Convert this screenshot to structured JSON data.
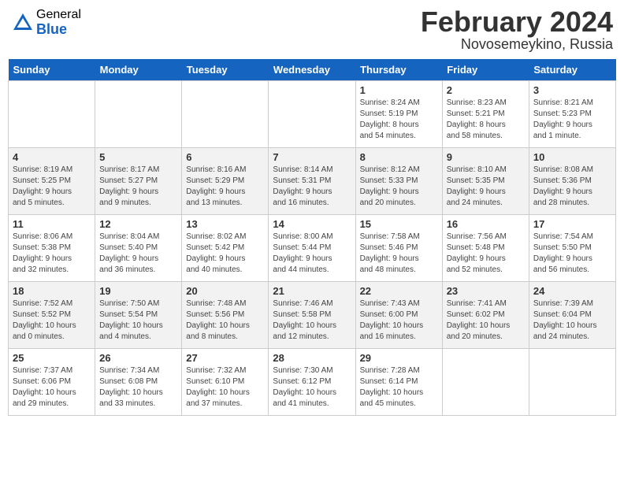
{
  "logo": {
    "general": "General",
    "blue": "Blue"
  },
  "title": {
    "month_year": "February 2024",
    "location": "Novosemeykino, Russia"
  },
  "headers": [
    "Sunday",
    "Monday",
    "Tuesday",
    "Wednesday",
    "Thursday",
    "Friday",
    "Saturday"
  ],
  "weeks": [
    [
      {
        "day": "",
        "info": ""
      },
      {
        "day": "",
        "info": ""
      },
      {
        "day": "",
        "info": ""
      },
      {
        "day": "",
        "info": ""
      },
      {
        "day": "1",
        "info": "Sunrise: 8:24 AM\nSunset: 5:19 PM\nDaylight: 8 hours\nand 54 minutes."
      },
      {
        "day": "2",
        "info": "Sunrise: 8:23 AM\nSunset: 5:21 PM\nDaylight: 8 hours\nand 58 minutes."
      },
      {
        "day": "3",
        "info": "Sunrise: 8:21 AM\nSunset: 5:23 PM\nDaylight: 9 hours\nand 1 minute."
      }
    ],
    [
      {
        "day": "4",
        "info": "Sunrise: 8:19 AM\nSunset: 5:25 PM\nDaylight: 9 hours\nand 5 minutes."
      },
      {
        "day": "5",
        "info": "Sunrise: 8:17 AM\nSunset: 5:27 PM\nDaylight: 9 hours\nand 9 minutes."
      },
      {
        "day": "6",
        "info": "Sunrise: 8:16 AM\nSunset: 5:29 PM\nDaylight: 9 hours\nand 13 minutes."
      },
      {
        "day": "7",
        "info": "Sunrise: 8:14 AM\nSunset: 5:31 PM\nDaylight: 9 hours\nand 16 minutes."
      },
      {
        "day": "8",
        "info": "Sunrise: 8:12 AM\nSunset: 5:33 PM\nDaylight: 9 hours\nand 20 minutes."
      },
      {
        "day": "9",
        "info": "Sunrise: 8:10 AM\nSunset: 5:35 PM\nDaylight: 9 hours\nand 24 minutes."
      },
      {
        "day": "10",
        "info": "Sunrise: 8:08 AM\nSunset: 5:36 PM\nDaylight: 9 hours\nand 28 minutes."
      }
    ],
    [
      {
        "day": "11",
        "info": "Sunrise: 8:06 AM\nSunset: 5:38 PM\nDaylight: 9 hours\nand 32 minutes."
      },
      {
        "day": "12",
        "info": "Sunrise: 8:04 AM\nSunset: 5:40 PM\nDaylight: 9 hours\nand 36 minutes."
      },
      {
        "day": "13",
        "info": "Sunrise: 8:02 AM\nSunset: 5:42 PM\nDaylight: 9 hours\nand 40 minutes."
      },
      {
        "day": "14",
        "info": "Sunrise: 8:00 AM\nSunset: 5:44 PM\nDaylight: 9 hours\nand 44 minutes."
      },
      {
        "day": "15",
        "info": "Sunrise: 7:58 AM\nSunset: 5:46 PM\nDaylight: 9 hours\nand 48 minutes."
      },
      {
        "day": "16",
        "info": "Sunrise: 7:56 AM\nSunset: 5:48 PM\nDaylight: 9 hours\nand 52 minutes."
      },
      {
        "day": "17",
        "info": "Sunrise: 7:54 AM\nSunset: 5:50 PM\nDaylight: 9 hours\nand 56 minutes."
      }
    ],
    [
      {
        "day": "18",
        "info": "Sunrise: 7:52 AM\nSunset: 5:52 PM\nDaylight: 10 hours\nand 0 minutes."
      },
      {
        "day": "19",
        "info": "Sunrise: 7:50 AM\nSunset: 5:54 PM\nDaylight: 10 hours\nand 4 minutes."
      },
      {
        "day": "20",
        "info": "Sunrise: 7:48 AM\nSunset: 5:56 PM\nDaylight: 10 hours\nand 8 minutes."
      },
      {
        "day": "21",
        "info": "Sunrise: 7:46 AM\nSunset: 5:58 PM\nDaylight: 10 hours\nand 12 minutes."
      },
      {
        "day": "22",
        "info": "Sunrise: 7:43 AM\nSunset: 6:00 PM\nDaylight: 10 hours\nand 16 minutes."
      },
      {
        "day": "23",
        "info": "Sunrise: 7:41 AM\nSunset: 6:02 PM\nDaylight: 10 hours\nand 20 minutes."
      },
      {
        "day": "24",
        "info": "Sunrise: 7:39 AM\nSunset: 6:04 PM\nDaylight: 10 hours\nand 24 minutes."
      }
    ],
    [
      {
        "day": "25",
        "info": "Sunrise: 7:37 AM\nSunset: 6:06 PM\nDaylight: 10 hours\nand 29 minutes."
      },
      {
        "day": "26",
        "info": "Sunrise: 7:34 AM\nSunset: 6:08 PM\nDaylight: 10 hours\nand 33 minutes."
      },
      {
        "day": "27",
        "info": "Sunrise: 7:32 AM\nSunset: 6:10 PM\nDaylight: 10 hours\nand 37 minutes."
      },
      {
        "day": "28",
        "info": "Sunrise: 7:30 AM\nSunset: 6:12 PM\nDaylight: 10 hours\nand 41 minutes."
      },
      {
        "day": "29",
        "info": "Sunrise: 7:28 AM\nSunset: 6:14 PM\nDaylight: 10 hours\nand 45 minutes."
      },
      {
        "day": "",
        "info": ""
      },
      {
        "day": "",
        "info": ""
      }
    ]
  ]
}
